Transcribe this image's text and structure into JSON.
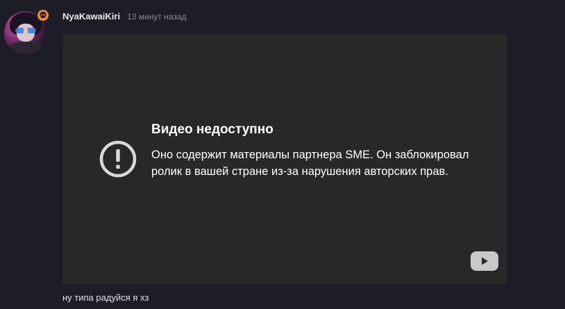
{
  "post": {
    "username": "NyaKawaiKiri",
    "timestamp": "13 минут назад",
    "badge_icon": "skull-icon",
    "badge_color": "#e8893a"
  },
  "video": {
    "title": "Видео недоступно",
    "body": "Оно содержит материалы партнера SME. Он заблокировал ролик в вашей стране из-за нарушения авторских прав.",
    "status_icon": "alert-circle-icon",
    "player_button_icon": "youtube-play-icon",
    "background_color": "#282828"
  },
  "comment": {
    "text": "ну типа радуйся я хз"
  },
  "colors": {
    "page_background": "#1c1d26",
    "timestamp_text": "#8a8b9c"
  }
}
